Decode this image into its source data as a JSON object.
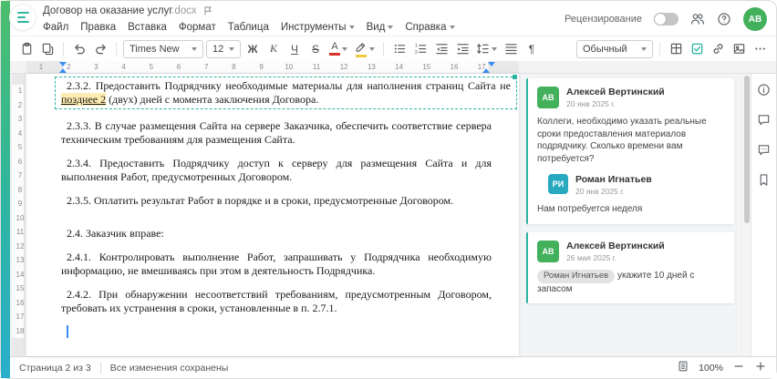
{
  "window": {
    "title": "Договор на оказание услуг",
    "title_ext": ".docx"
  },
  "header": {
    "review_label": "Рецензирование",
    "review_enabled": false,
    "avatar_initials": "АВ"
  },
  "menubar": {
    "items": [
      "Файл",
      "Правка",
      "Вставка",
      "Формат",
      "Таблица",
      "Инструменты",
      "Вид",
      "Справка"
    ]
  },
  "toolbar": {
    "font_name": "Times New",
    "font_size": "12",
    "bold_glyph": "Ж",
    "italic_glyph": "К",
    "underline_glyph": "Ч",
    "strike_glyph": "S",
    "font_color_glyph": "А",
    "pilcrow_glyph": "¶",
    "style_name": "Обычный"
  },
  "ruler": {
    "h": [
      "1",
      "2",
      "3",
      "4",
      "5",
      "6",
      "7",
      "8",
      "9",
      "10",
      "11",
      "12",
      "13",
      "14",
      "15",
      "16",
      "17"
    ],
    "v": [
      "1",
      "2",
      "3",
      "4",
      "5",
      "6",
      "7",
      "8",
      "9",
      "10",
      "11",
      "12",
      "13",
      "14",
      "15",
      "16",
      "17",
      "18"
    ]
  },
  "document": {
    "paragraphs": [
      {
        "text_before": "2.3.2. Предоставить Подрядчику необходимые материалы для наполнения страниц Сайта не ",
        "anchor": "позднее 2",
        "text_after": " (двух) дней с момента заключения Договора."
      },
      {
        "text": "2.3.3. В случае размещения Сайта на сервере Заказчика, обеспечить соответствие сервера техническим требованиям для размещения Сайта."
      },
      {
        "text": "2.3.4. Предоставить Подрядчику доступ к серверу для размещения Сайта и для выполнения Работ, предусмотренных Договором."
      },
      {
        "text": "2.3.5. Оплатить результат Работ в порядке и в сроки, предусмотренные Договором."
      },
      {
        "text": "2.4. Заказчик вправе:"
      },
      {
        "text": "2.4.1. Контролировать выполнение Работ, запрашивать у Подрядчика необходимую информацию, не вмешиваясь при этом в деятельность Подрядчика."
      },
      {
        "text": "2.4.2. При обнаружении несоответствий требованиям, предусмотренным Договором, требовать их устранения в сроки, установленные в п. 2.7.1."
      }
    ]
  },
  "comments": {
    "thread1": {
      "initials": "АВ",
      "author": "Алексей Вертинский",
      "date": "20 янв 2025 г.",
      "text": "Коллеги, необходимо указать реальные сроки предоставления материалов подрядчику. Сколько времени вам потребуется?",
      "reply": {
        "initials": "РИ",
        "author": "Роман Игнатьев",
        "date": "20 янв 2025 г.",
        "text": "Нам потребуется неделя"
      }
    },
    "thread2": {
      "initials": "АВ",
      "author": "Алексей Вертинский",
      "date": "26 мая 2025 г.",
      "mention": "Роман Игнатьев",
      "text": "укажите 10 дней с запасом"
    }
  },
  "statusbar": {
    "page_label": "Страница 2 из 3",
    "saved_label": "Все изменения сохранены",
    "zoom_value": "100%"
  },
  "colors": {
    "accent": "#2eb5a2",
    "green": "#43b05c",
    "teal": "#29a9c0",
    "blue": "#3a8ef5",
    "red": "#d93025",
    "yellow": "#f3c93c",
    "hl": "#ffecb3"
  }
}
